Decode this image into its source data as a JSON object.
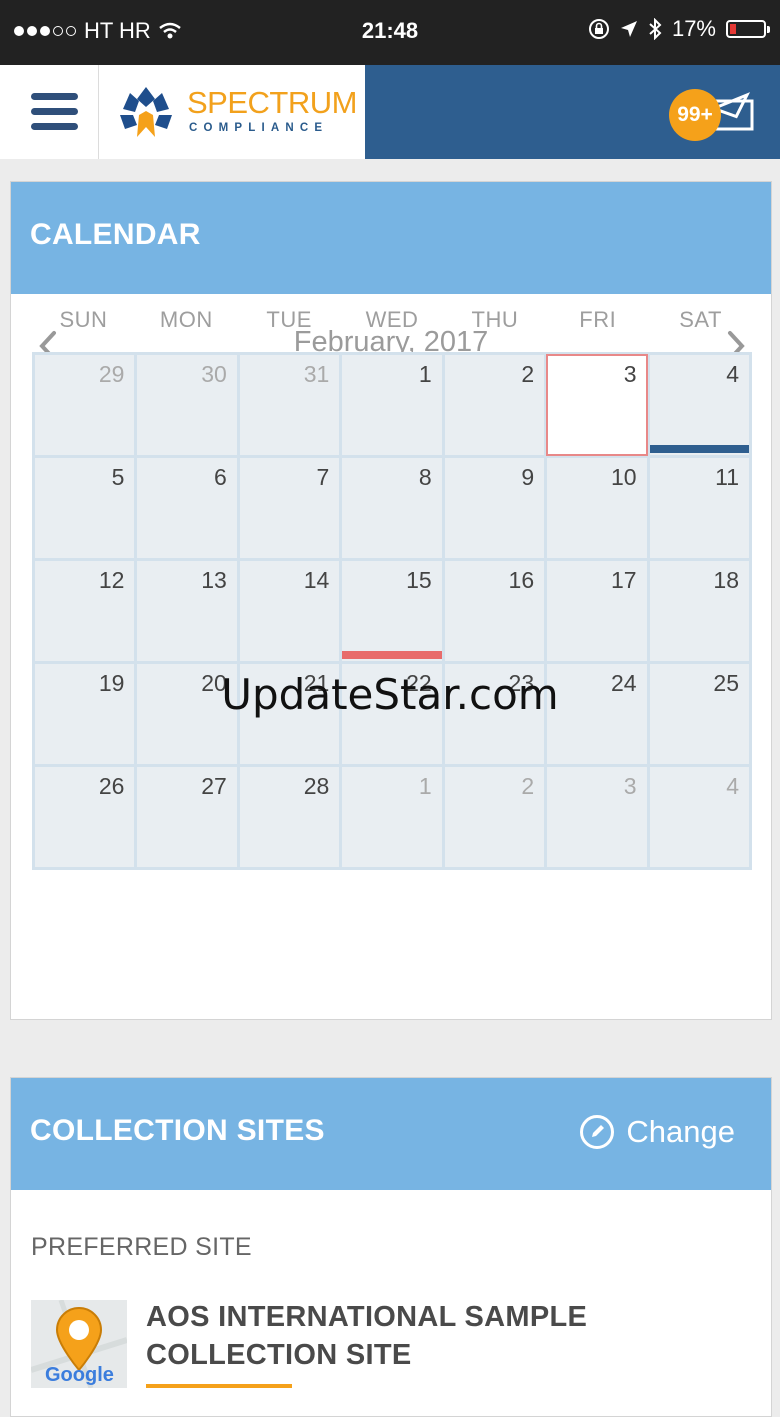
{
  "status_bar": {
    "carrier": "HT HR",
    "time": "21:48",
    "battery": "17%"
  },
  "header": {
    "logo_title": "SPECTRUM",
    "logo_subtitle": "COMPLIANCE",
    "notification_count": "99+",
    "colors": {
      "header_blue": "#2e5e8f",
      "badge_orange": "#f5a11a"
    }
  },
  "calendar": {
    "title": "CALENDAR",
    "month_label": "February, 2017",
    "weekdays": [
      "SUN",
      "MON",
      "TUE",
      "WED",
      "THU",
      "FRI",
      "SAT"
    ],
    "days": [
      {
        "d": "29",
        "other": true
      },
      {
        "d": "30",
        "other": true
      },
      {
        "d": "31",
        "other": true
      },
      {
        "d": "1"
      },
      {
        "d": "2"
      },
      {
        "d": "3",
        "today": true
      },
      {
        "d": "4",
        "event": "#2e5e8f"
      },
      {
        "d": "5"
      },
      {
        "d": "6"
      },
      {
        "d": "7"
      },
      {
        "d": "8"
      },
      {
        "d": "9"
      },
      {
        "d": "10"
      },
      {
        "d": "11"
      },
      {
        "d": "12"
      },
      {
        "d": "13"
      },
      {
        "d": "14"
      },
      {
        "d": "15",
        "event": "#e86b6b"
      },
      {
        "d": "16"
      },
      {
        "d": "17"
      },
      {
        "d": "18"
      },
      {
        "d": "19"
      },
      {
        "d": "20"
      },
      {
        "d": "21"
      },
      {
        "d": "22"
      },
      {
        "d": "23"
      },
      {
        "d": "24"
      },
      {
        "d": "25"
      },
      {
        "d": "26"
      },
      {
        "d": "27"
      },
      {
        "d": "28"
      },
      {
        "d": "1",
        "other": true
      },
      {
        "d": "2",
        "other": true
      },
      {
        "d": "3",
        "other": true
      },
      {
        "d": "4",
        "other": true
      }
    ]
  },
  "collection_sites": {
    "title": "COLLECTION SITES",
    "change_label": "Change",
    "preferred_label": "PREFERRED SITE",
    "site_name": "AOS INTERNATIONAL SAMPLE COLLECTION SITE",
    "map_logo_text": "Google"
  },
  "watermark": "UpdateStar.com"
}
